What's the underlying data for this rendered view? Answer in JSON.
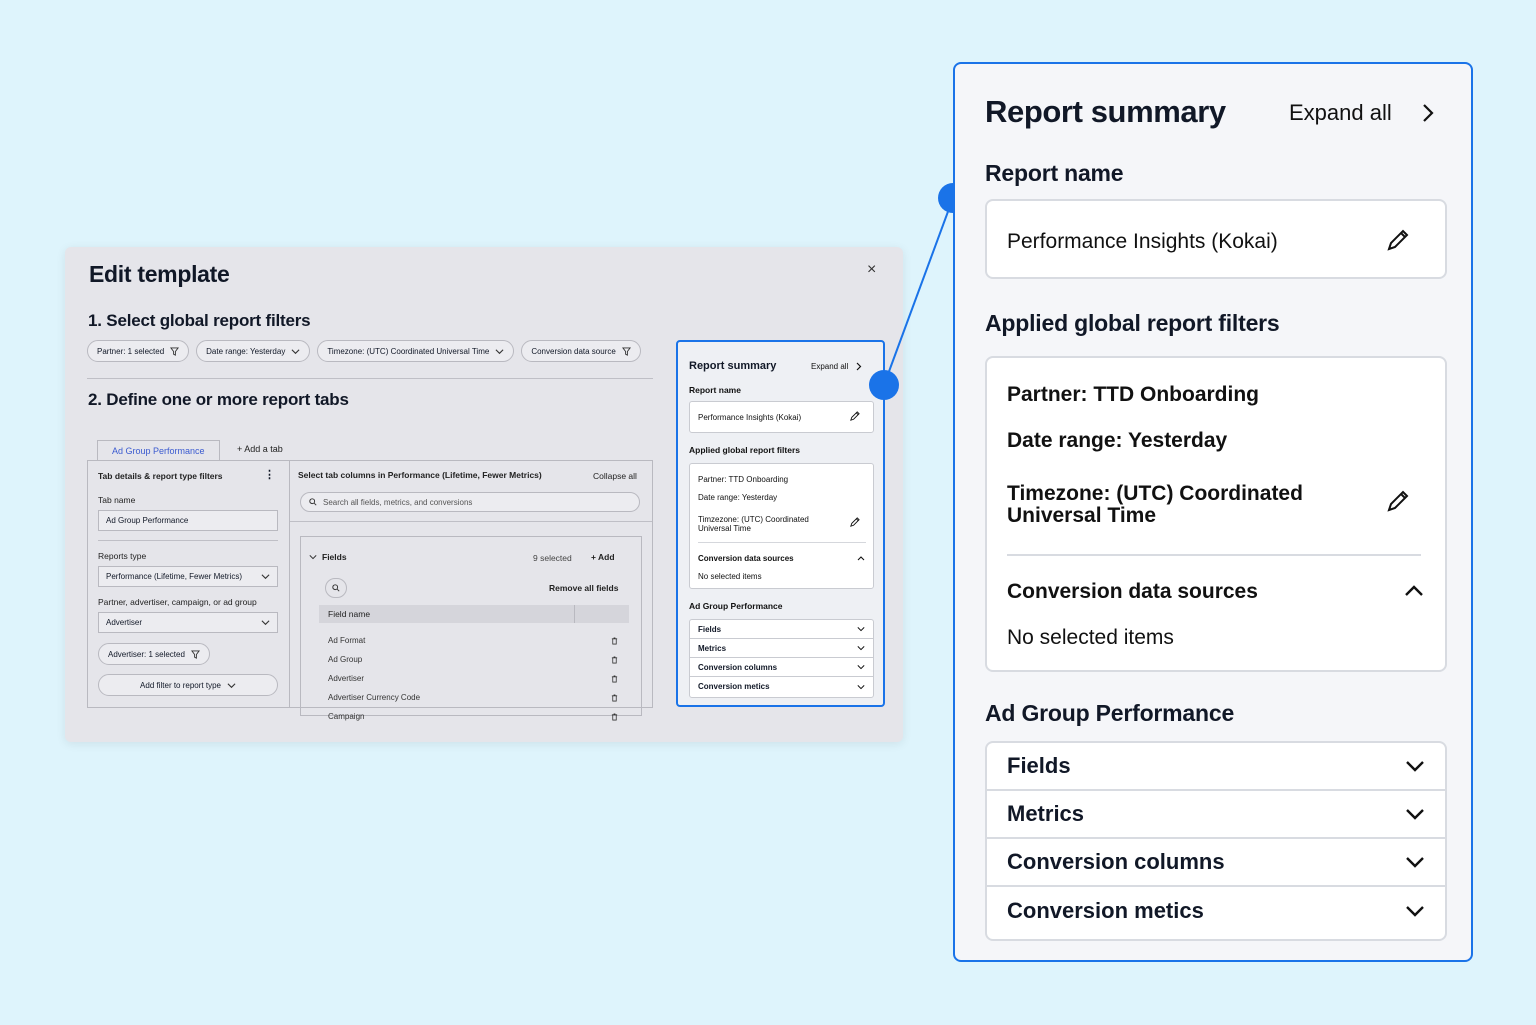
{
  "modal": {
    "title": "Edit template",
    "close": "×",
    "section1": "1. Select global report filters",
    "chips": [
      {
        "label": "Partner: 1 selected",
        "icon": "filter-icon"
      },
      {
        "label": "Date range: Yesterday",
        "icon": "chevron-down-icon"
      },
      {
        "label": "Timezone: (UTC) Coordinated Universal Time",
        "icon": "chevron-down-icon"
      },
      {
        "label": "Conversion data source",
        "icon": "filter-icon"
      }
    ],
    "section2": "2. Define one or more report tabs",
    "tabs": {
      "active": "Ad Group Performance",
      "add": "+  Add a tab"
    },
    "left": {
      "header": "Tab details & report type filters",
      "tab_name_label": "Tab name",
      "tab_name_value": "Ad Group Performance",
      "reports_type_label": "Reports type",
      "reports_type_value": "Performance (Lifetime, Fewer Metrics)",
      "group_label": "Partner, advertiser, campaign, or ad group",
      "group_value": "Advertiser",
      "advertiser_chip": "Advertiser: 1 selected",
      "add_filter": "Add filter to report type"
    },
    "right": {
      "header": "Select tab columns in Performance (Lifetime, Fewer Metrics)",
      "collapse": "Collapse all",
      "search_placeholder": "Search all fields, metrics, and conversions",
      "fields_label": "Fields",
      "selected": "9 selected",
      "add": "+  Add",
      "remove_all": "Remove all fields",
      "col_header": "Field name",
      "rows": [
        "Ad Format",
        "Ad Group",
        "Advertiser",
        "Advertiser Currency Code",
        "Campaign"
      ]
    },
    "mini": {
      "title": "Report summary",
      "expand": "Expand all",
      "report_name_label": "Report name",
      "report_name": "Performance Insights (Kokai)",
      "filters_label": "Applied global report filters",
      "partner": "Partner: TTD Onboarding",
      "date": "Date range: Yesterday",
      "timezone": "Timzezone: (UTC) Coordinated Universal Time",
      "conv": "Conversion data sources",
      "no_items": "No selected items",
      "group_label": "Ad Group Performance",
      "accordions": [
        "Fields",
        "Metrics",
        "Conversion columns",
        "Conversion metics"
      ]
    }
  },
  "summary": {
    "title": "Report summary",
    "expand": "Expand all",
    "report_name_label": "Report name",
    "report_name": "Performance Insights (Kokai)",
    "filters_label": "Applied global report filters",
    "partner": "Partner: TTD Onboarding",
    "date": "Date range: Yesterday",
    "timezone": "Timezone: (UTC) Coordinated Universal Time",
    "conv": "Conversion data sources",
    "no_items": "No selected items",
    "group_label": "Ad Group Performance",
    "accordions": [
      "Fields",
      "Metrics",
      "Conversion columns",
      "Conversion metics"
    ]
  },
  "colors": {
    "accent": "#1a73e8",
    "background": "#def4fc",
    "tab_text": "#3b5bd0"
  }
}
